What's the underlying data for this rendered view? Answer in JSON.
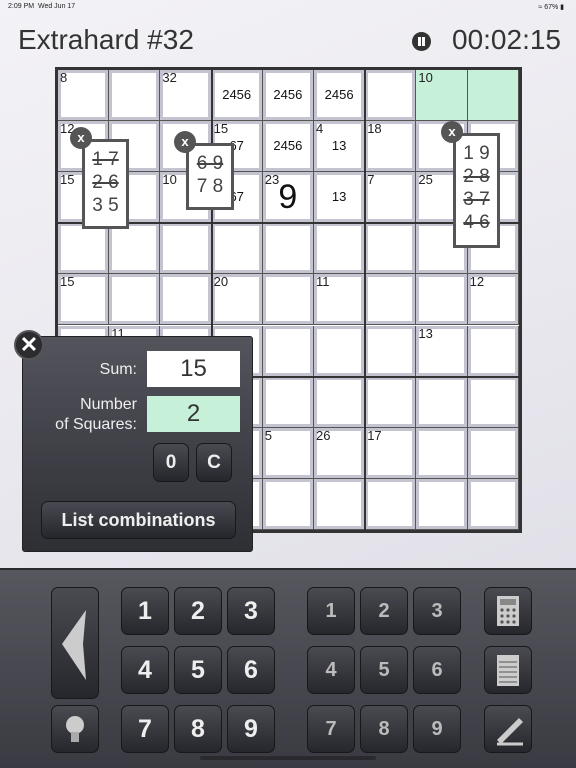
{
  "status": {
    "time": "2:09 PM",
    "date": "Wed Jun 17",
    "battery": "67%"
  },
  "header": {
    "title": "Extrahard #32",
    "timer": "00:02:15",
    "pause_icon": "pause-icon"
  },
  "colors": {
    "highlight": "#c6f0d8",
    "panel": "#3a3b42"
  },
  "grid": {
    "cages": [
      [
        0,
        0,
        "8"
      ],
      [
        0,
        2,
        "32"
      ],
      [
        0,
        7,
        "10"
      ],
      [
        1,
        0,
        "12"
      ],
      [
        1,
        3,
        "15"
      ],
      [
        1,
        5,
        "4"
      ],
      [
        1,
        6,
        "18"
      ],
      [
        2,
        0,
        "15"
      ],
      [
        2,
        2,
        "10"
      ],
      [
        2,
        4,
        "23"
      ],
      [
        2,
        6,
        "7"
      ],
      [
        2,
        7,
        "25"
      ],
      [
        4,
        0,
        "15"
      ],
      [
        4,
        3,
        "20"
      ],
      [
        4,
        5,
        "11"
      ],
      [
        4,
        8,
        "12"
      ],
      [
        5,
        1,
        "11"
      ],
      [
        5,
        7,
        "13"
      ],
      [
        7,
        4,
        "5"
      ],
      [
        7,
        5,
        "26"
      ],
      [
        7,
        6,
        "17"
      ]
    ],
    "pencil": [
      [
        0,
        3,
        "2456"
      ],
      [
        0,
        4,
        "2456"
      ],
      [
        0,
        5,
        "2456"
      ],
      [
        1,
        3,
        "67"
      ],
      [
        1,
        4,
        "2456"
      ],
      [
        1,
        5,
        "13"
      ],
      [
        2,
        3,
        "67"
      ],
      [
        2,
        5,
        "13"
      ]
    ],
    "values": [
      [
        2,
        4,
        "9"
      ]
    ],
    "highlighted": [
      [
        0,
        7
      ],
      [
        0,
        8
      ]
    ]
  },
  "combo_popups": [
    {
      "close": "x",
      "rows": [
        {
          "t": "1 7",
          "struck": true
        },
        {
          "t": "2 6",
          "struck": true
        },
        {
          "t": "3 5",
          "struck": false
        }
      ]
    },
    {
      "close": "x",
      "rows": [
        {
          "t": "6 9",
          "struck": true
        },
        {
          "t": "7 8",
          "struck": false
        }
      ]
    },
    {
      "close": "x",
      "rows": [
        {
          "t": "1 9",
          "struck": false
        },
        {
          "t": "2 8",
          "struck": true
        },
        {
          "t": "3 7",
          "struck": true
        },
        {
          "t": "4 6",
          "struck": true
        }
      ]
    }
  ],
  "calculator": {
    "sum_label": "Sum:",
    "sum_value": "15",
    "count_label_1": "Number",
    "count_label_2": "of Squares:",
    "count_value": "2",
    "zero": "0",
    "clear": "C",
    "list": "List combinations"
  },
  "keypad": {
    "digits": [
      "1",
      "2",
      "3",
      "4",
      "5",
      "6",
      "7",
      "8",
      "9"
    ],
    "pencil_digits": [
      "1",
      "2",
      "3",
      "4",
      "5",
      "6",
      "7",
      "8",
      "9"
    ]
  }
}
